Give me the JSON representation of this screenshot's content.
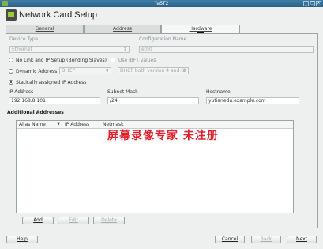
{
  "window": {
    "title": "YaST2"
  },
  "header": {
    "title": "Network Card Setup"
  },
  "tabs": [
    {
      "label": "General",
      "active": false
    },
    {
      "label": "Address",
      "active": false
    },
    {
      "label": "Hardware",
      "active": true
    }
  ],
  "device": {
    "device_type_label": "Device Type",
    "device_type_value": "Ethernet",
    "config_name_label": "Configuration Name",
    "config_name_value": "eth0"
  },
  "options": {
    "no_link_label": "No Link and IP Setup (Bonding Slaves)",
    "use_ibft_label": "Use iBFT values",
    "dynamic_label": "Dynamic Address",
    "dynamic_mode": "DHCP",
    "dhcp_version": "DHCP both version 4 and 6",
    "static_label": "Statically assigned IP Address",
    "selected": "static"
  },
  "static_ip": {
    "ip_label": "IP Address",
    "ip_value": "192.168.8.101",
    "mask_label": "Subnet Mask",
    "mask_value": "/24",
    "host_label": "Hostname",
    "host_value": "yutianedu.example.com"
  },
  "additional": {
    "title": "Additional Addresses",
    "columns": [
      "Alias Name",
      "IP Address",
      "Netmask"
    ],
    "rows": [],
    "add_label": "Add",
    "edit_label": "Edit",
    "delete_label": "Delete"
  },
  "watermark": {
    "text": "屏幕录像专家 未注册"
  },
  "footer": {
    "help_label": "Help",
    "cancel_label": "Cancel",
    "back_label": "Back",
    "next_label": "Next"
  },
  "colors": {
    "titlebar": "#2a5f86",
    "watermark": "#e0202c",
    "panel_bg": "#edf0ef"
  }
}
